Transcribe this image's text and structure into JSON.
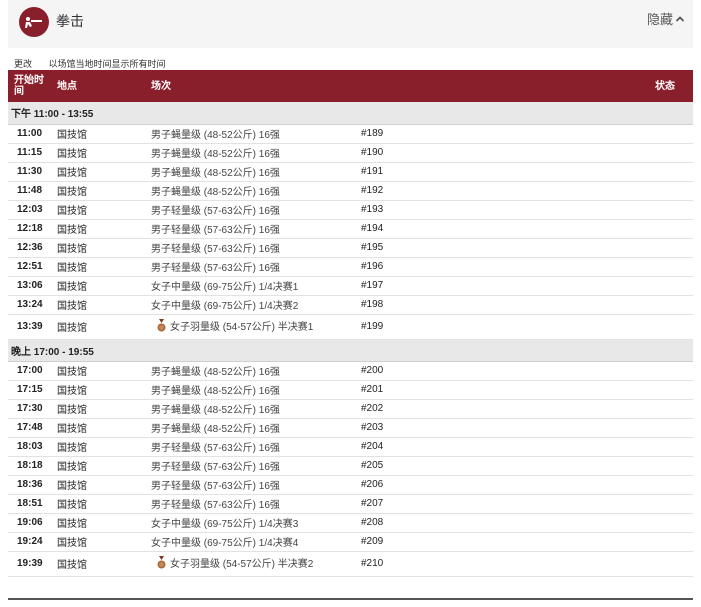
{
  "header": {
    "sport_title": "拳击",
    "hide_label": "隐藏"
  },
  "subbar": {
    "change_label": "更改",
    "timezone_note": "以场馆当地时间显示所有时间"
  },
  "table": {
    "columns": {
      "start_time_line1": "开始时",
      "start_time_line2": "间",
      "venue": "地点",
      "session": "场次",
      "status": "状态"
    },
    "sections": [
      {
        "label": "下午  11:00 - 13:55",
        "rows": [
          {
            "time": "11:00",
            "venue": "国技馆",
            "event": "男子蝇量级 (48-52公斤) 16强",
            "number": "#189",
            "medal": false
          },
          {
            "time": "11:15",
            "venue": "国技馆",
            "event": "男子蝇量级 (48-52公斤) 16强",
            "number": "#190",
            "medal": false
          },
          {
            "time": "11:30",
            "venue": "国技馆",
            "event": "男子蝇量级 (48-52公斤) 16强",
            "number": "#191",
            "medal": false
          },
          {
            "time": "11:48",
            "venue": "国技馆",
            "event": "男子蝇量级 (48-52公斤) 16强",
            "number": "#192",
            "medal": false
          },
          {
            "time": "12:03",
            "venue": "国技馆",
            "event": "男子轻量级 (57-63公斤) 16强",
            "number": "#193",
            "medal": false
          },
          {
            "time": "12:18",
            "venue": "国技馆",
            "event": "男子轻量级 (57-63公斤) 16强",
            "number": "#194",
            "medal": false
          },
          {
            "time": "12:36",
            "venue": "国技馆",
            "event": "男子轻量级 (57-63公斤) 16强",
            "number": "#195",
            "medal": false
          },
          {
            "time": "12:51",
            "venue": "国技馆",
            "event": "男子轻量级 (57-63公斤) 16强",
            "number": "#196",
            "medal": false
          },
          {
            "time": "13:06",
            "venue": "国技馆",
            "event": "女子中量级 (69-75公斤) 1/4决赛1",
            "number": "#197",
            "medal": false
          },
          {
            "time": "13:24",
            "venue": "国技馆",
            "event": "女子中量级 (69-75公斤) 1/4决赛2",
            "number": "#198",
            "medal": false
          },
          {
            "time": "13:39",
            "venue": "国技馆",
            "event": "女子羽量级 (54-57公斤) 半决赛1",
            "number": "#199",
            "medal": true
          }
        ]
      },
      {
        "label": "晚上  17:00 - 19:55",
        "rows": [
          {
            "time": "17:00",
            "venue": "国技馆",
            "event": "男子蝇量级 (48-52公斤) 16强",
            "number": "#200",
            "medal": false
          },
          {
            "time": "17:15",
            "venue": "国技馆",
            "event": "男子蝇量级 (48-52公斤) 16强",
            "number": "#201",
            "medal": false
          },
          {
            "time": "17:30",
            "venue": "国技馆",
            "event": "男子蝇量级 (48-52公斤) 16强",
            "number": "#202",
            "medal": false
          },
          {
            "time": "17:48",
            "venue": "国技馆",
            "event": "男子蝇量级 (48-52公斤) 16强",
            "number": "#203",
            "medal": false
          },
          {
            "time": "18:03",
            "venue": "国技馆",
            "event": "男子轻量级 (57-63公斤) 16强",
            "number": "#204",
            "medal": false
          },
          {
            "time": "18:18",
            "venue": "国技馆",
            "event": "男子轻量级 (57-63公斤) 16强",
            "number": "#205",
            "medal": false
          },
          {
            "time": "18:36",
            "venue": "国技馆",
            "event": "男子轻量级 (57-63公斤) 16强",
            "number": "#206",
            "medal": false
          },
          {
            "time": "18:51",
            "venue": "国技馆",
            "event": "男子轻量级 (57-63公斤) 16强",
            "number": "#207",
            "medal": false
          },
          {
            "time": "19:06",
            "venue": "国技馆",
            "event": "女子中量级 (69-75公斤) 1/4决赛3",
            "number": "#208",
            "medal": false
          },
          {
            "time": "19:24",
            "venue": "国技馆",
            "event": "女子中量级 (69-75公斤) 1/4决赛4",
            "number": "#209",
            "medal": false
          },
          {
            "time": "19:39",
            "venue": "国技馆",
            "event": "女子羽量级 (54-57公斤) 半决赛2",
            "number": "#210",
            "medal": true
          }
        ]
      }
    ]
  },
  "colors": {
    "brand": "#8a1f2c",
    "section_bg": "#e8e8e8",
    "medal_bronze": "#a8683a"
  },
  "icons": {
    "sport": "boxing-pictogram-icon",
    "hide": "chevron-up-icon",
    "medal": "bronze-medal-icon"
  }
}
